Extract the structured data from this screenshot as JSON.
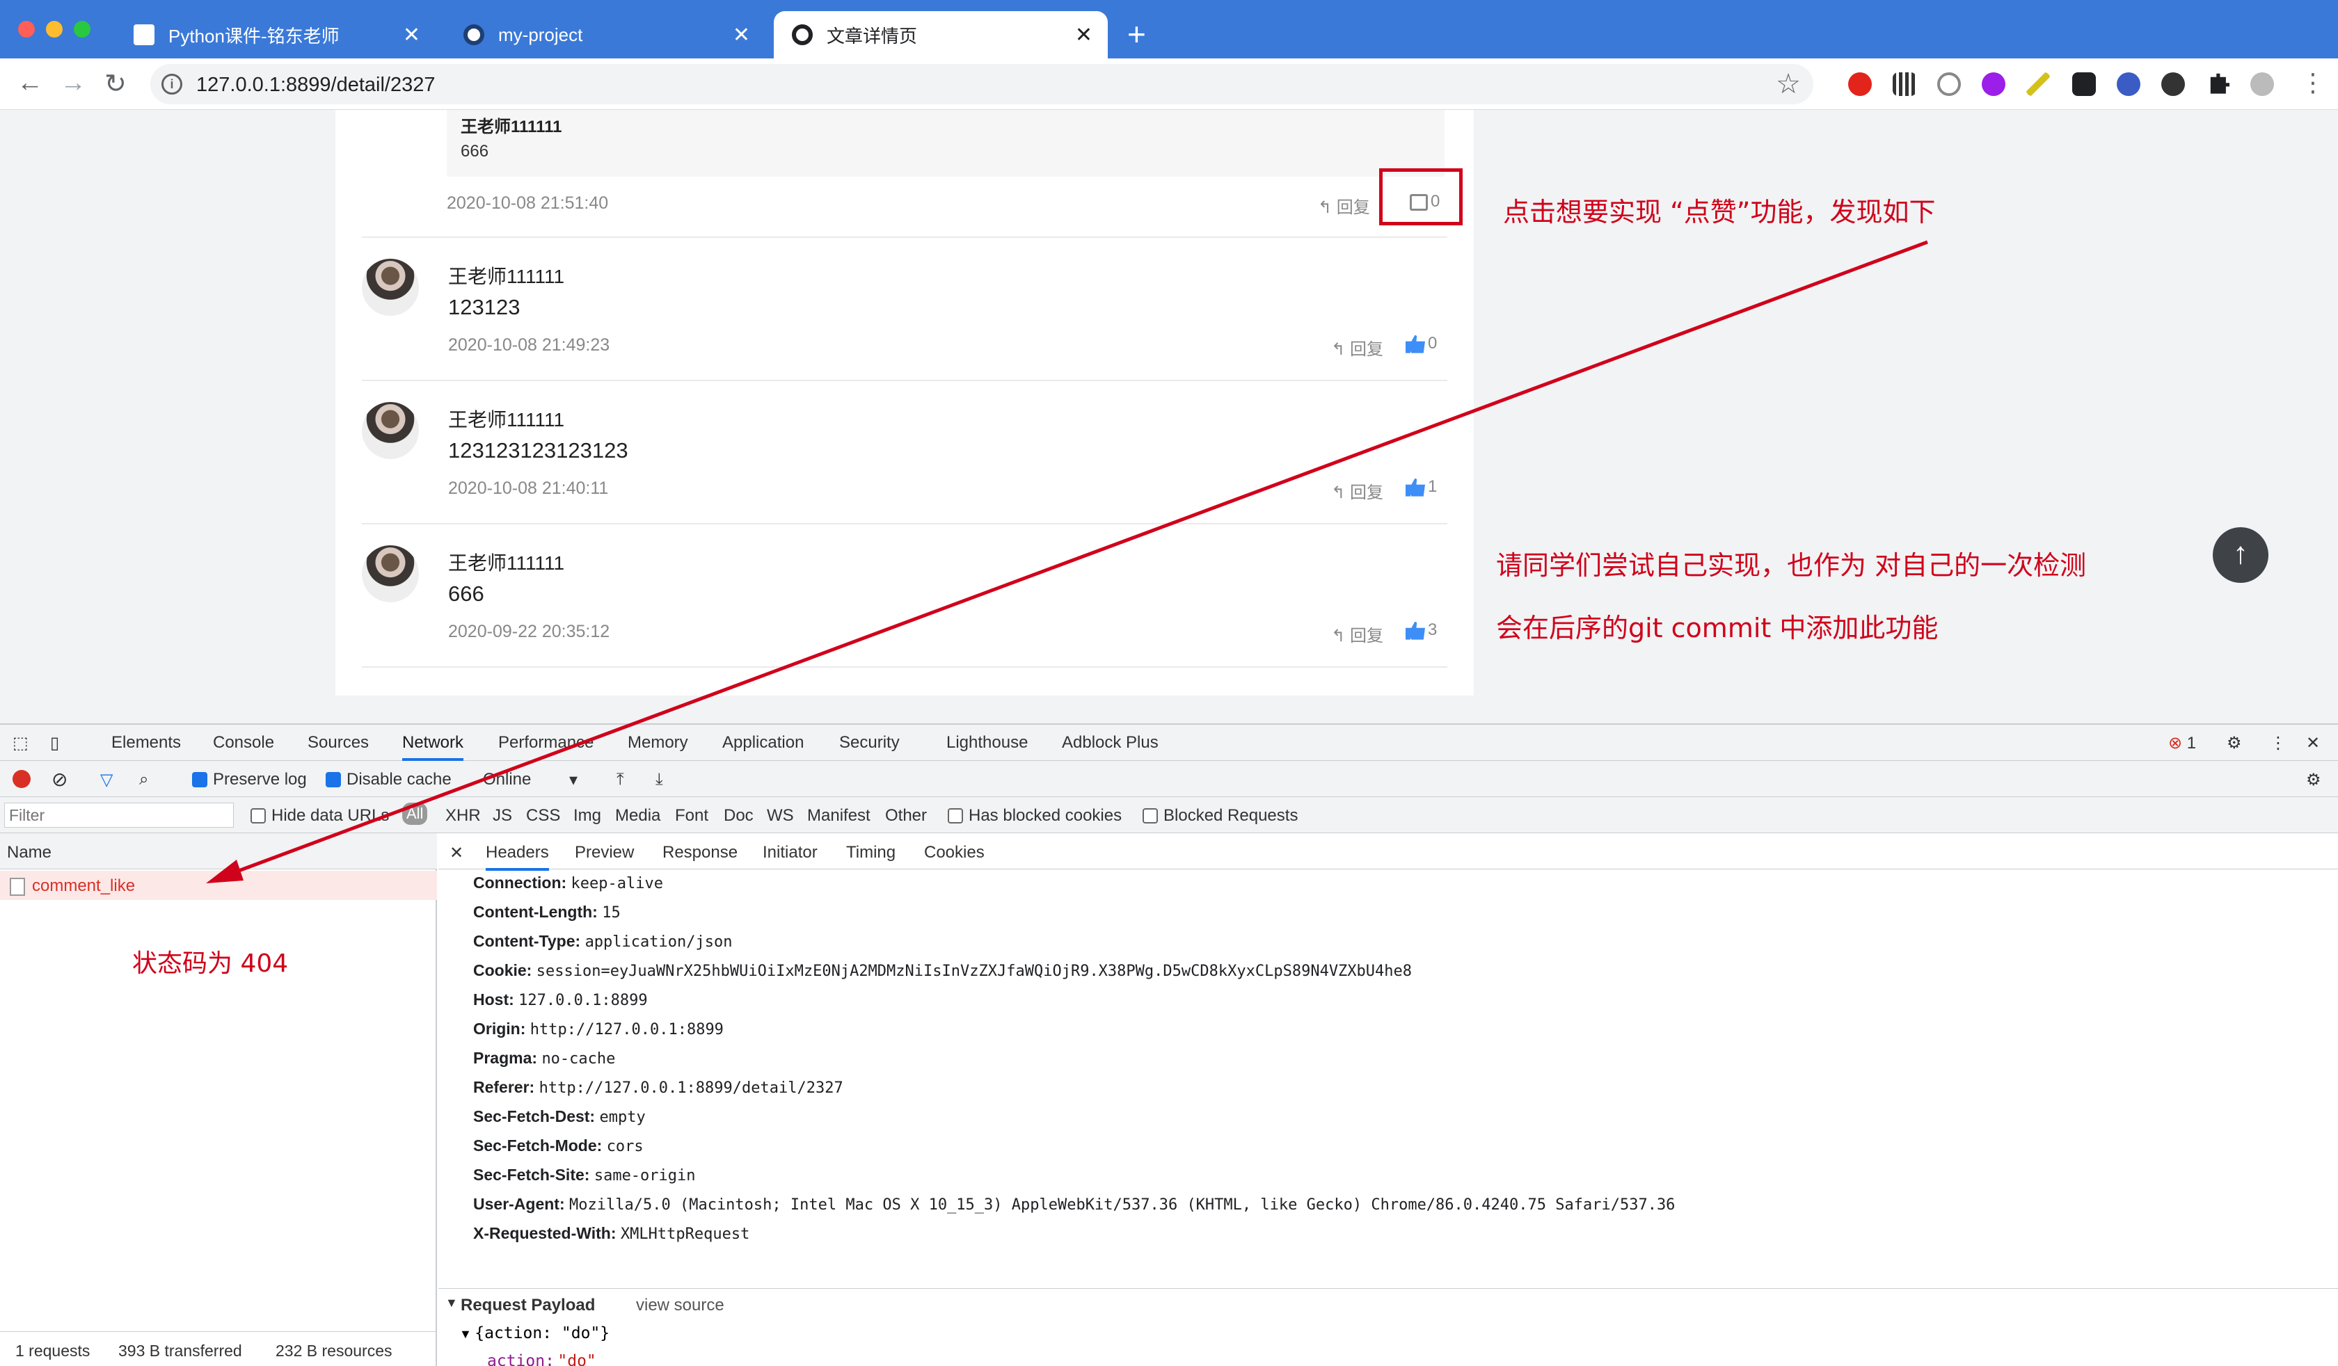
{
  "browser": {
    "tabs": [
      {
        "label": "Python课件-铭东老师"
      },
      {
        "label": "my-project"
      },
      {
        "label": "文章详情页"
      }
    ],
    "url": "127.0.0.1:8899/detail/2327"
  },
  "page": {
    "quoted_reply": {
      "author": "王老师111111",
      "text": "666"
    },
    "first_time": "2020-10-08 21:51:40",
    "reply_label": "回复",
    "first_likes": "0",
    "comments": [
      {
        "author": "王老师111111",
        "text": "123123",
        "time": "2020-10-08 21:49:23",
        "likes": "0"
      },
      {
        "author": "王老师111111",
        "text": "123123123123123",
        "time": "2020-10-08 21:40:11",
        "likes": "1"
      },
      {
        "author": "王老师111111",
        "text": "666",
        "time": "2020-09-22 20:35:12",
        "likes": "3"
      }
    ],
    "scroll_top": "↑"
  },
  "annotations": {
    "click_like": "点击想要实现 “点赞”功能，发现如下",
    "try_self": "请同学们尝试自己实现，也作为 对自己的一次检测",
    "future_commit": "会在后序的git commit 中添加此功能",
    "status_404": "状态码为 404"
  },
  "devtools": {
    "tabs": [
      "Elements",
      "Console",
      "Sources",
      "Network",
      "Performance",
      "Memory",
      "Application",
      "Security",
      "Lighthouse",
      "Adblock Plus"
    ],
    "error_count": "1",
    "preserve_log": "Preserve log",
    "disable_cache": "Disable cache",
    "throttle": "Online",
    "filter_placeholder": "Filter",
    "hide_data_urls": "Hide data URLs",
    "filter_types": [
      "All",
      "XHR",
      "JS",
      "CSS",
      "Img",
      "Media",
      "Font",
      "Doc",
      "WS",
      "Manifest",
      "Other"
    ],
    "has_blocked_cookies": "Has blocked cookies",
    "blocked_requests": "Blocked Requests",
    "name_header": "Name",
    "request_name": "comment_like",
    "status": {
      "requests": "1 requests",
      "transferred": "393 B transferred",
      "resources": "232 B resources"
    },
    "subtabs": [
      "Headers",
      "Preview",
      "Response",
      "Initiator",
      "Timing",
      "Cookies"
    ],
    "headers": [
      {
        "k": "Connection:",
        "v": "keep-alive"
      },
      {
        "k": "Content-Length:",
        "v": "15"
      },
      {
        "k": "Content-Type:",
        "v": "application/json"
      },
      {
        "k": "Cookie:",
        "v": "session=eyJuaWNrX25hbWUiOiIxMzE0NjA2MDMzNiIsInVzZXJfaWQiOjR9.X38PWg.D5wCD8kXyxCLpS89N4VZXbU4he8"
      },
      {
        "k": "Host:",
        "v": "127.0.0.1:8899"
      },
      {
        "k": "Origin:",
        "v": "http://127.0.0.1:8899"
      },
      {
        "k": "Pragma:",
        "v": "no-cache"
      },
      {
        "k": "Referer:",
        "v": "http://127.0.0.1:8899/detail/2327"
      },
      {
        "k": "Sec-Fetch-Dest:",
        "v": "empty"
      },
      {
        "k": "Sec-Fetch-Mode:",
        "v": "cors"
      },
      {
        "k": "Sec-Fetch-Site:",
        "v": "same-origin"
      },
      {
        "k": "User-Agent:",
        "v": "Mozilla/5.0 (Macintosh; Intel Mac OS X 10_15_3) AppleWebKit/537.36 (KHTML, like Gecko) Chrome/86.0.4240.75 Safari/537.36"
      },
      {
        "k": "X-Requested-With:",
        "v": "XMLHttpRequest"
      }
    ],
    "payload_title": "Request Payload",
    "view_source": "view source",
    "payload_summary": "{action: \"do\"}",
    "payload_key": "action:",
    "payload_value": "\"do\""
  },
  "colors": {
    "annotation": "#d0021b",
    "chrome_blue": "#3a79d8",
    "like_blue": "#3d8ef7"
  }
}
